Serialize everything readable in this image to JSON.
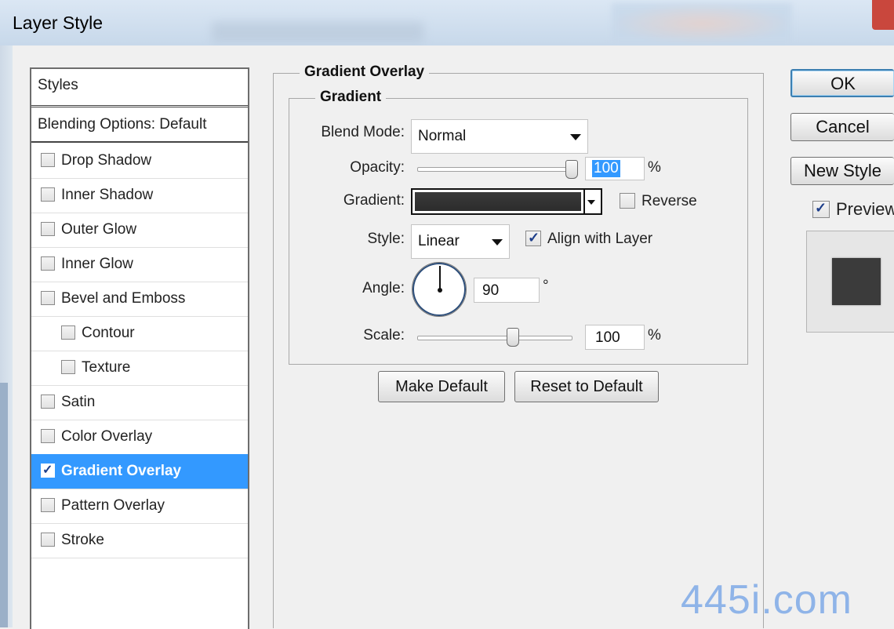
{
  "window": {
    "title": "Layer Style"
  },
  "styles_panel": {
    "header": "Styles",
    "blending_options": "Blending Options: Default",
    "items": [
      {
        "label": "Drop Shadow",
        "checked": false
      },
      {
        "label": "Inner Shadow",
        "checked": false
      },
      {
        "label": "Outer Glow",
        "checked": false
      },
      {
        "label": "Inner Glow",
        "checked": false
      },
      {
        "label": "Bevel and Emboss",
        "checked": false
      },
      {
        "label": "Contour",
        "checked": false
      },
      {
        "label": "Texture",
        "checked": false
      },
      {
        "label": "Satin",
        "checked": false
      },
      {
        "label": "Color Overlay",
        "checked": false
      },
      {
        "label": "Gradient Overlay",
        "checked": true,
        "selected": true
      },
      {
        "label": "Pattern Overlay",
        "checked": false
      },
      {
        "label": "Stroke",
        "checked": false
      }
    ],
    "selected_color": "#3399ff"
  },
  "gradient_overlay": {
    "title": "Gradient Overlay",
    "group_title": "Gradient",
    "blend_mode_label": "Blend Mode:",
    "blend_mode_value": "Normal",
    "opacity_label": "Opacity:",
    "opacity_value": "100",
    "opacity_unit": "%",
    "gradient_label": "Gradient:",
    "reverse_label": "Reverse",
    "reverse_checked": false,
    "style_label": "Style:",
    "style_value": "Linear",
    "align_label": "Align with Layer",
    "align_checked": true,
    "angle_label": "Angle:",
    "angle_value": "90",
    "angle_unit": "°",
    "scale_label": "Scale:",
    "scale_value": "100",
    "scale_unit": "%",
    "make_default": "Make Default",
    "reset_default": "Reset to Default"
  },
  "side_buttons": {
    "ok": "OK",
    "cancel": "Cancel",
    "new_style": "New Style",
    "preview_label": "Preview",
    "preview_checked": true
  },
  "icons": [
    "checkbox-check-icon",
    "dropdown-arrow-icon",
    "angle-dial-icon",
    "slider-thumb-icon",
    "window-close-icon"
  ],
  "watermark": "445i.com"
}
